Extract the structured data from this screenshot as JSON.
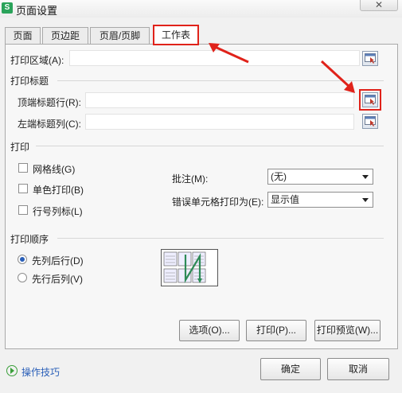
{
  "window": {
    "title": "页面设置",
    "close_label": "✕"
  },
  "tabs": [
    {
      "label": "页面"
    },
    {
      "label": "页边距"
    },
    {
      "label": "页眉/页脚"
    },
    {
      "label": "工作表"
    }
  ],
  "print_area": {
    "label": "打印区域(A):",
    "value": ""
  },
  "print_titles": {
    "heading": "打印标题",
    "top_rows_label": "顶端标题行(R):",
    "top_rows_value": "",
    "left_cols_label": "左端标题列(C):",
    "left_cols_value": ""
  },
  "print": {
    "heading": "打印",
    "gridlines": {
      "label": "网格线(G)",
      "checked": false
    },
    "mono": {
      "label": "单色打印(B)",
      "checked": false
    },
    "row_col_headings": {
      "label": "行号列标(L)",
      "checked": false
    },
    "comments_label": "批注(M):",
    "comments_value": "(无)",
    "errors_label": "错误单元格打印为(E):",
    "errors_value": "显示值"
  },
  "page_order": {
    "heading": "打印顺序",
    "down_then_over": {
      "label": "先列后行(D)",
      "selected": true
    },
    "over_then_down": {
      "label": "先行后列(V)",
      "selected": false
    }
  },
  "buttons": {
    "options": "选项(O)...",
    "print": "打印(P)...",
    "print_preview": "打印预览(W)...",
    "ok": "确定",
    "cancel": "取消"
  },
  "footer": {
    "tips_link": "操作技巧"
  },
  "colors": {
    "annotation_red": "#e0221a",
    "link_blue": "#2a5fb8",
    "accent_green": "#2aa35a"
  }
}
